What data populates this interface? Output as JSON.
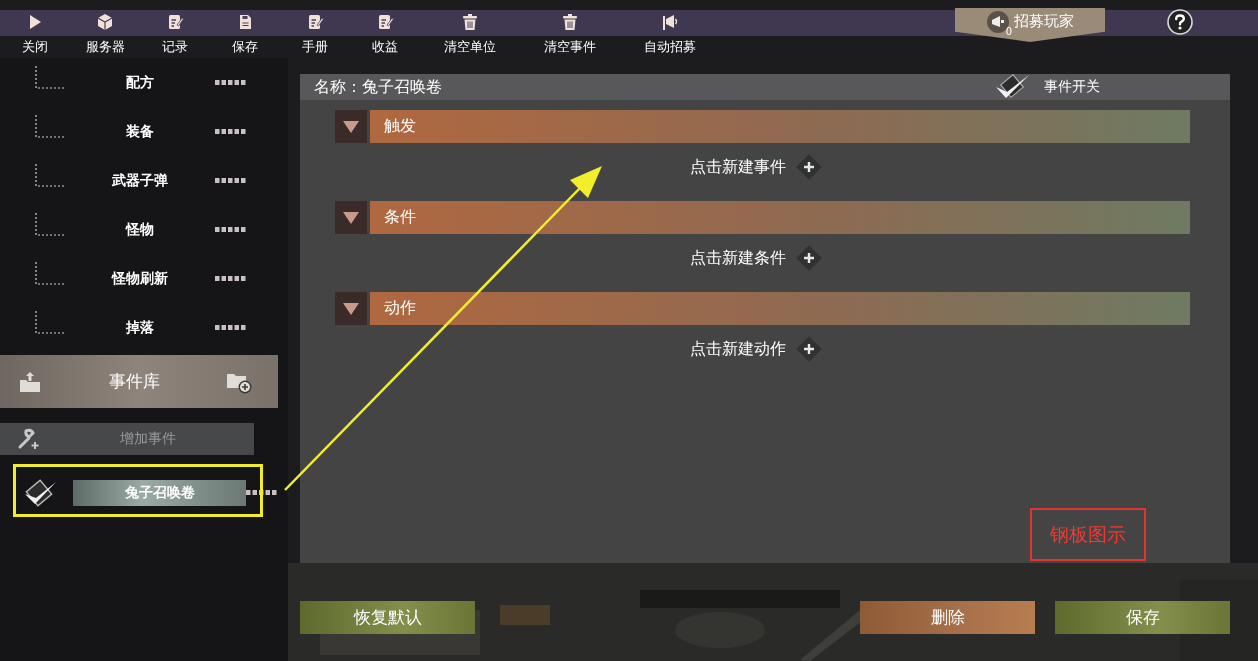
{
  "toolbar": {
    "items": [
      {
        "label": "关闭",
        "kind": "play"
      },
      {
        "label": "服务器",
        "kind": "cube"
      },
      {
        "label": "记录",
        "kind": "note"
      },
      {
        "label": "保存",
        "kind": "disk"
      },
      {
        "label": "手册",
        "kind": "note"
      },
      {
        "label": "收益",
        "kind": "note"
      },
      {
        "label": "清空单位",
        "kind": "trash"
      },
      {
        "label": "清空事件",
        "kind": "trash"
      },
      {
        "label": "自动招募",
        "kind": "megaphone"
      }
    ]
  },
  "recruit": {
    "label": "招募玩家",
    "count": "0"
  },
  "sidebar": {
    "tree_items": [
      {
        "label": "配方"
      },
      {
        "label": "装备"
      },
      {
        "label": "武器子弹"
      },
      {
        "label": "怪物"
      },
      {
        "label": "怪物刷新"
      },
      {
        "label": "掉落"
      }
    ],
    "library": {
      "title": "事件库"
    },
    "add_event": {
      "label": "增加事件"
    },
    "events": [
      {
        "name": "兔子召唤卷",
        "checked": true,
        "highlighted": true
      }
    ]
  },
  "editor": {
    "name_label": "名称：兔子召唤卷",
    "event_switch": {
      "label": "事件开关",
      "checked": true
    },
    "sections": [
      {
        "title": "触发",
        "expanded": true,
        "add_label": "点击新建事件"
      },
      {
        "title": "条件",
        "expanded": true,
        "add_label": "点击新建条件"
      },
      {
        "title": "动作",
        "expanded": true,
        "add_label": "点击新建动作"
      }
    ],
    "annotation": {
      "label": "钢板图示"
    }
  },
  "buttons": [
    {
      "label": "恢复默认",
      "kind": "default"
    },
    {
      "label": "删除",
      "kind": "danger"
    },
    {
      "label": "保存",
      "kind": "primary"
    }
  ]
}
